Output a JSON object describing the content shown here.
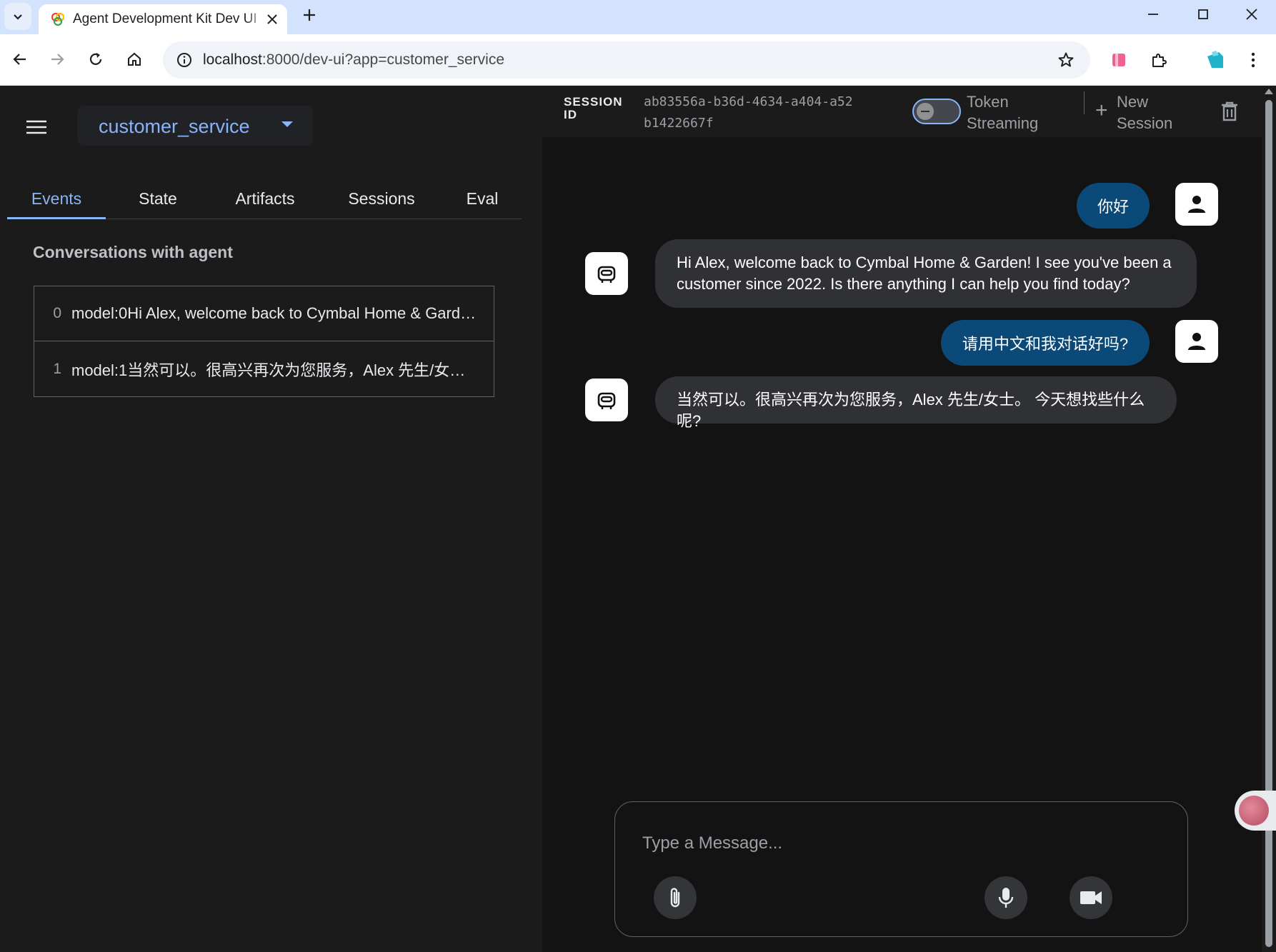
{
  "browser": {
    "tab_title": "Agent Development Kit Dev UI",
    "url_host": "localhost",
    "url_rest": ":8000/dev-ui?app=customer_service"
  },
  "app": {
    "selected_app": "customer_service",
    "tabs": [
      "Events",
      "State",
      "Artifacts",
      "Sessions",
      "Eval"
    ],
    "active_tab": "Events",
    "conversations_title": "Conversations with agent",
    "events": [
      {
        "index": "0",
        "text": "model:0Hi Alex, welcome back to Cymbal Home & Garden! I see you've been a customer since 2022."
      },
      {
        "index": "1",
        "text": "model:1当然可以。很高兴再次为您服务，Alex 先生/女士。 今天想找些什么呢?"
      }
    ]
  },
  "header": {
    "session_label_1": "SESSION",
    "session_label_2": "ID",
    "session_id": "ab83556a-b36d-4634-a404-a52b1422667f",
    "token_label_1": "Token",
    "token_label_2": "Streaming",
    "token_streaming_on": false,
    "new_session_1": "New",
    "new_session_2": "Session"
  },
  "messages": [
    {
      "role": "user",
      "text": "你好"
    },
    {
      "role": "bot",
      "text_1": "Hi Alex, welcome back to Cymbal Home & Garden! I see you've been a",
      "text_2": "customer since 2022. Is there anything I can help you find today?"
    },
    {
      "role": "user",
      "text": "请用中文和我对话好吗?"
    },
    {
      "role": "bot",
      "text_1": "当然可以。很高兴再次为您服务，Alex 先生/女士。 今天想找些什么呢?"
    }
  ],
  "input": {
    "placeholder": "Type a Message..."
  },
  "colors": {
    "accent": "#8ab4f8",
    "user_bubble": "#0b4a78",
    "bot_bubble": "#303134"
  }
}
